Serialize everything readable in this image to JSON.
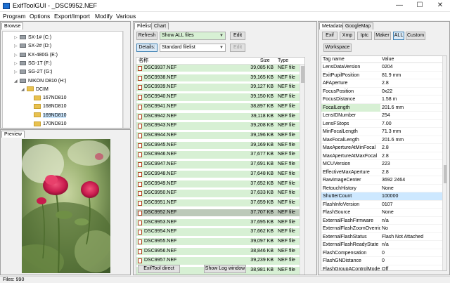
{
  "window": {
    "title": "ExifToolGUI - _DSC9952.NEF",
    "minimize": "—",
    "maximize": "☐",
    "close": "✕"
  },
  "menu": {
    "program": "Program",
    "options": "Options",
    "export_import": "Export/Import",
    "modify": "Modify",
    "various": "Various"
  },
  "browse": {
    "tab": "Browse",
    "tree": [
      {
        "label": "SX-1# (C:)",
        "kind": "drive",
        "level": 1,
        "toggle": "▷"
      },
      {
        "label": "SX-2# (D:)",
        "kind": "drive",
        "level": 1,
        "toggle": "▷"
      },
      {
        "label": "KX-480G (E:)",
        "kind": "drive",
        "level": 1,
        "toggle": "▷"
      },
      {
        "label": "SG-1T (F:)",
        "kind": "drive",
        "level": 1,
        "toggle": "▷"
      },
      {
        "label": "SG-2T (G:)",
        "kind": "drive",
        "level": 1,
        "toggle": "▷"
      },
      {
        "label": "NIKON D810 (H:)",
        "kind": "drive",
        "level": 1,
        "toggle": "◢"
      },
      {
        "label": "DCIM",
        "kind": "folder",
        "level": 2,
        "toggle": "◢"
      },
      {
        "label": "167ND810",
        "kind": "folder",
        "level": 3,
        "toggle": ""
      },
      {
        "label": "168ND810",
        "kind": "folder",
        "level": 3,
        "toggle": ""
      },
      {
        "label": "169ND810",
        "kind": "folder",
        "level": 3,
        "toggle": "",
        "selected": true
      },
      {
        "label": "170ND810",
        "kind": "folder",
        "level": 3,
        "toggle": ""
      },
      {
        "label": "e (\\\\192.168.3.199) (X:)",
        "kind": "drive",
        "level": 1,
        "toggle": "▷"
      }
    ]
  },
  "preview": {
    "tab": "Preview"
  },
  "center": {
    "tab_filelist": "Filelist",
    "tab_chart": "Chart",
    "refresh_label": "Refresh",
    "filter_value": "Show ALL files",
    "edit1_label": "Edit",
    "details_label": "Details:",
    "view_value": "Standard filelist",
    "edit2_label": "Edit",
    "columns": {
      "name": "名称",
      "size": "Size",
      "type": "Type"
    },
    "files": [
      {
        "name": "DSC9937.NEF",
        "size": "39,085 KB",
        "type": "NEF file"
      },
      {
        "name": "DSC9938.NEF",
        "size": "39,165 KB",
        "type": "NEF file"
      },
      {
        "name": "DSC9939.NEF",
        "size": "39,127 KB",
        "type": "NEF file"
      },
      {
        "name": "DSC9940.NEF",
        "size": "39,150 KB",
        "type": "NEF file"
      },
      {
        "name": "DSC9941.NEF",
        "size": "38,897 KB",
        "type": "NEF file"
      },
      {
        "name": "DSC9942.NEF",
        "size": "39,118 KB",
        "type": "NEF file"
      },
      {
        "name": "DSC9943.NEF",
        "size": "39,208 KB",
        "type": "NEF file"
      },
      {
        "name": "DSC9944.NEF",
        "size": "39,196 KB",
        "type": "NEF file"
      },
      {
        "name": "DSC9945.NEF",
        "size": "39,169 KB",
        "type": "NEF file"
      },
      {
        "name": "DSC9946.NEF",
        "size": "37,677 KB",
        "type": "NEF file"
      },
      {
        "name": "DSC9947.NEF",
        "size": "37,691 KB",
        "type": "NEF file"
      },
      {
        "name": "DSC9948.NEF",
        "size": "37,648 KB",
        "type": "NEF file"
      },
      {
        "name": "DSC9949.NEF",
        "size": "37,652 KB",
        "type": "NEF file"
      },
      {
        "name": "DSC9950.NEF",
        "size": "37,633 KB",
        "type": "NEF file"
      },
      {
        "name": "DSC9951.NEF",
        "size": "37,659 KB",
        "type": "NEF file"
      },
      {
        "name": "DSC9952.NEF",
        "size": "37,707 KB",
        "type": "NEF file",
        "selected": true
      },
      {
        "name": "DSC9953.NEF",
        "size": "37,695 KB",
        "type": "NEF file"
      },
      {
        "name": "DSC9954.NEF",
        "size": "37,662 KB",
        "type": "NEF file"
      },
      {
        "name": "DSC9955.NEF",
        "size": "39,097 KB",
        "type": "NEF file"
      },
      {
        "name": "DSC9956.NEF",
        "size": "38,846 KB",
        "type": "NEF file"
      },
      {
        "name": "DSC9957.NEF",
        "size": "39,239 KB",
        "type": "NEF file"
      },
      {
        "name": "DSC9958.NEF",
        "size": "38,981 KB",
        "type": "NEF file"
      }
    ],
    "exiftool_direct_label": "ExifTool direct",
    "show_log_label": "Show Log window"
  },
  "metadata": {
    "tab_metadata": "Metadata",
    "tab_googlemap": "GoogleMap",
    "buttons": [
      "Exif",
      "Xmp",
      "Iptc",
      "Maker",
      "ALL",
      "Custom"
    ],
    "workspace_label": "Workspace",
    "columns": {
      "tag": "Tag name",
      "value": "Value"
    },
    "rows": [
      {
        "tag": "LensDataVersion",
        "value": "0204"
      },
      {
        "tag": "ExitPupilPosition",
        "value": "81.9 mm"
      },
      {
        "tag": "AFAperture",
        "value": "2.8"
      },
      {
        "tag": "FocusPosition",
        "value": "0x22"
      },
      {
        "tag": "FocusDistance",
        "value": "1.58 m"
      },
      {
        "tag": "FocalLength",
        "value": "201.6 mm",
        "highlight": true
      },
      {
        "tag": "LensIDNumber",
        "value": "254"
      },
      {
        "tag": "LensFStops",
        "value": "7.00"
      },
      {
        "tag": "MinFocalLength",
        "value": "71.3 mm"
      },
      {
        "tag": "MaxFocalLength",
        "value": "201.6 mm"
      },
      {
        "tag": "MaxApertureAtMinFocal",
        "value": "2.8"
      },
      {
        "tag": "MaxApertureAtMaxFocal",
        "value": "2.8"
      },
      {
        "tag": "MCUVersion",
        "value": "223"
      },
      {
        "tag": "EffectiveMaxAperture",
        "value": "2.8"
      },
      {
        "tag": "RawImageCenter",
        "value": "3692 2464"
      },
      {
        "tag": "RetouchHistory",
        "value": "None"
      },
      {
        "tag": "ShutterCount",
        "value": "100000",
        "selected": true
      },
      {
        "tag": "FlashInfoVersion",
        "value": "0107"
      },
      {
        "tag": "FlashSource",
        "value": "None"
      },
      {
        "tag": "ExternalFlashFirmware",
        "value": "n/a"
      },
      {
        "tag": "ExternalFlashZoomOverrid",
        "value": "No"
      },
      {
        "tag": "ExternalFlashStatus",
        "value": "Flash Not Attached"
      },
      {
        "tag": "ExternalFlashReadyState",
        "value": "n/a"
      },
      {
        "tag": "FlashCompensation",
        "value": "0"
      },
      {
        "tag": "FlashGNDistance",
        "value": "0"
      },
      {
        "tag": "FlashGroupAControlMode",
        "value": "Off"
      }
    ]
  },
  "status": {
    "files": "Files: 990"
  }
}
